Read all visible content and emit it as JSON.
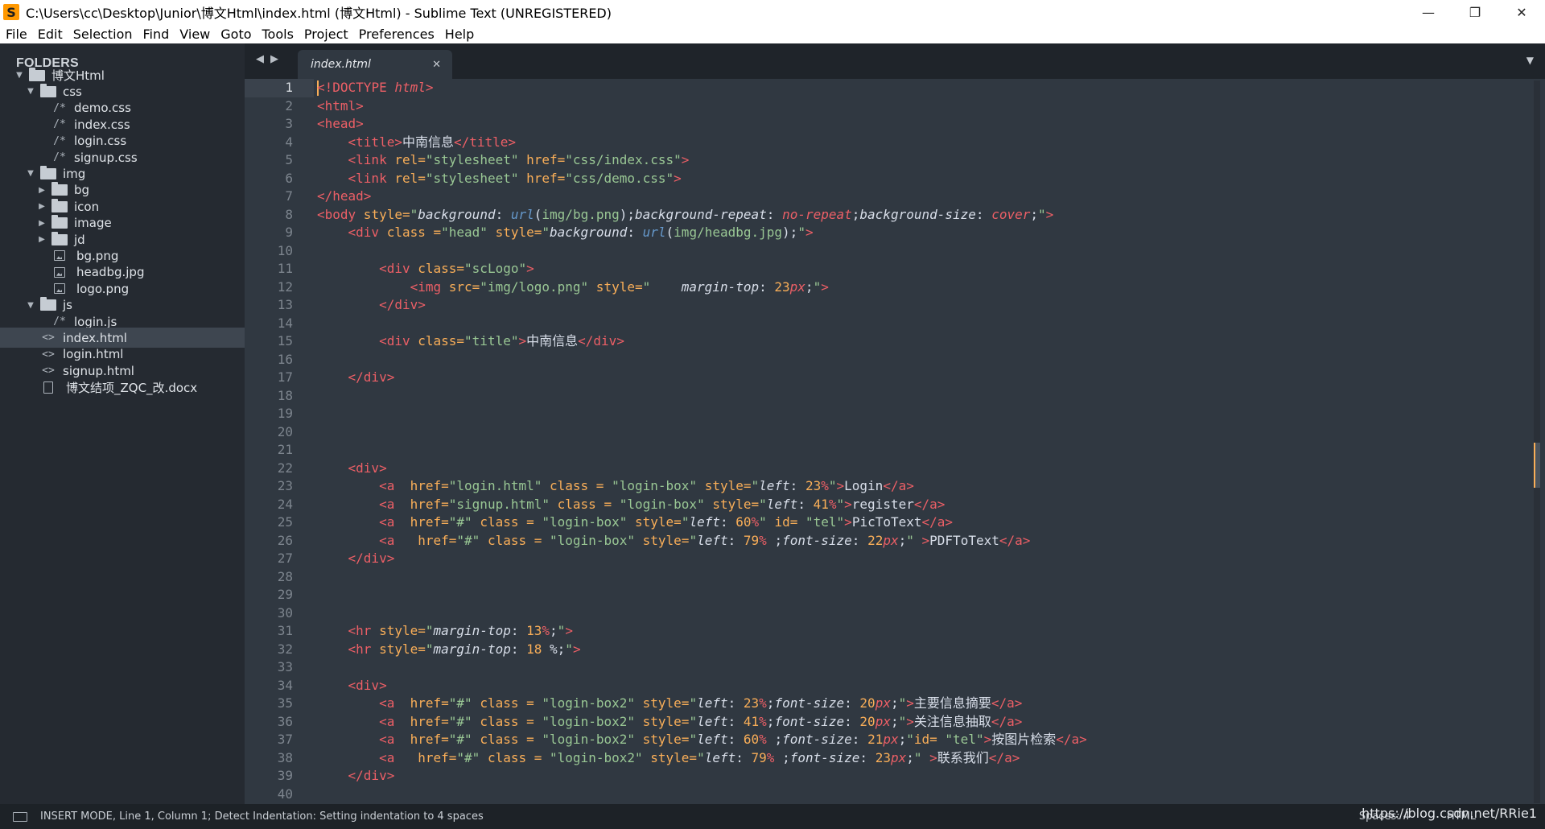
{
  "window": {
    "title": "C:\\Users\\cc\\Desktop\\Junior\\博文Html\\index.html (博文Html) - Sublime Text (UNREGISTERED)",
    "app_icon": "S",
    "controls": {
      "minimize": "—",
      "restore": "❐",
      "close": "✕"
    }
  },
  "menu": [
    "File",
    "Edit",
    "Selection",
    "Find",
    "View",
    "Goto",
    "Tools",
    "Project",
    "Preferences",
    "Help"
  ],
  "sidebar": {
    "header": "FOLDERS",
    "items": [
      {
        "label": "博文Html",
        "kind": "folder-open",
        "arrow": "▼"
      },
      {
        "label": "css",
        "kind": "folder-open",
        "arrow": "▼"
      },
      {
        "label": "demo.css",
        "kind": "code-file",
        "glyph": "/*"
      },
      {
        "label": "index.css",
        "kind": "code-file",
        "glyph": "/*"
      },
      {
        "label": "login.css",
        "kind": "code-file",
        "glyph": "/*"
      },
      {
        "label": "signup.css",
        "kind": "code-file",
        "glyph": "/*"
      },
      {
        "label": "img",
        "kind": "folder-open",
        "arrow": "▼"
      },
      {
        "label": "bg",
        "kind": "folder-closed",
        "arrow": "▶"
      },
      {
        "label": "icon",
        "kind": "folder-closed",
        "arrow": "▶"
      },
      {
        "label": "image",
        "kind": "folder-closed",
        "arrow": "▶"
      },
      {
        "label": "jd",
        "kind": "folder-closed",
        "arrow": "▶"
      },
      {
        "label": "bg.png",
        "kind": "image-file"
      },
      {
        "label": "headbg.jpg",
        "kind": "image-file"
      },
      {
        "label": "logo.png",
        "kind": "image-file"
      },
      {
        "label": "js",
        "kind": "folder-open",
        "arrow": "▼"
      },
      {
        "label": "login.js",
        "kind": "code-file",
        "glyph": "/*"
      },
      {
        "label": "index.html",
        "kind": "html-file",
        "glyph": "<>",
        "selected": true
      },
      {
        "label": "login.html",
        "kind": "html-file",
        "glyph": "<>"
      },
      {
        "label": "signup.html",
        "kind": "html-file",
        "glyph": "<>"
      },
      {
        "label": "博文结项_ZQC_改.docx",
        "kind": "doc-file"
      }
    ]
  },
  "tabs": {
    "nav_left": "◀",
    "nav_right": "▶",
    "active": "index.html",
    "close": "✕",
    "menu": "▼"
  },
  "editor": {
    "cursor": {
      "line": 1,
      "column": 1
    },
    "lines": [
      "<!DOCTYPE html>",
      "<html>",
      "<head>",
      "    <title>中南信息</title>",
      "    <link rel=\"stylesheet\" href=\"css/index.css\">",
      "    <link rel=\"stylesheet\" href=\"css/demo.css\">",
      "</head>",
      "<body style=\"background: url(img/bg.png);background-repeat: no-repeat;background-size: cover;\">",
      "    <div class =\"head\" style=\"background: url(img/headbg.jpg);\">",
      "",
      "        <div class=\"scLogo\">",
      "            <img src=\"img/logo.png\" style=\"    margin-top: 23px;\">",
      "        </div>",
      "",
      "        <div class=\"title\">中南信息</div>",
      "",
      "    </div>",
      "",
      "",
      "",
      "",
      "    <div>",
      "        <a  href=\"login.html\" class = \"login-box\" style=\"left: 23%\">Login</a>",
      "        <a  href=\"signup.html\" class = \"login-box\" style=\"left: 41%\">register</a>",
      "        <a  href=\"#\" class = \"login-box\" style=\"left: 60%\" id= \"tel\">PicToText</a>",
      "        <a   href=\"#\" class = \"login-box\" style=\"left: 79% ;font-size: 22px;\" >PDFToText</a>",
      "    </div>",
      "",
      "",
      "",
      "    <hr style=\"margin-top: 13%;\">",
      "    <hr style=\"margin-top: 18 %;\">",
      "",
      "    <div>",
      "        <a  href=\"#\" class = \"login-box2\" style=\"left: 23%;font-size: 20px;\">主要信息摘要</a>",
      "        <a  href=\"#\" class = \"login-box2\" style=\"left: 41%;font-size: 20px;\">关注信息抽取</a>",
      "        <a  href=\"#\" class = \"login-box2\" style=\"left: 60% ;font-size: 21px;\"id= \"tel\">按图片检索</a>",
      "        <a   href=\"#\" class = \"login-box2\" style=\"left: 79% ;font-size: 23px;\" >联系我们</a>",
      "    </div>",
      ""
    ]
  },
  "statusbar": {
    "message": "INSERT MODE, Line 1, Column 1; Detect Indentation: Setting indentation to 4 spaces",
    "spaces": "Spaces: 4",
    "syntax": "HTML",
    "watermark": "https://blog.csdn.net/RRie1"
  },
  "colors": {
    "editor_bg": "#303841",
    "sidebar_bg": "#252a31",
    "tag": "#ec5f66",
    "attribute": "#f9ae58",
    "string": "#99c794",
    "function": "#6699cc"
  }
}
